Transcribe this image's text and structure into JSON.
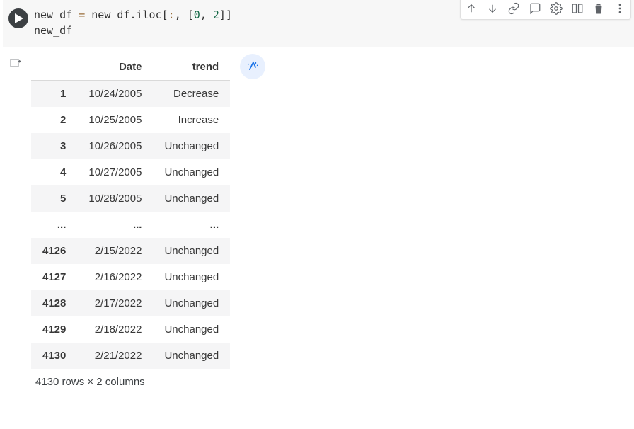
{
  "code": {
    "line1_pre": "new_df ",
    "line1_eq": "=",
    "line1_mid": " new_df.iloc",
    "line1_b1": "[",
    "line1_colon": ":",
    "line1_comma": ", ",
    "line1_b2": "[",
    "line1_n0": "0",
    "line1_sep": ", ",
    "line1_n2": "2",
    "line1_b3": "]",
    "line1_b4": "]",
    "line2": "new_df"
  },
  "columns": [
    "Date",
    "trend"
  ],
  "rows": [
    {
      "idx": "1",
      "Date": "10/24/2005",
      "trend": "Decrease"
    },
    {
      "idx": "2",
      "Date": "10/25/2005",
      "trend": "Increase"
    },
    {
      "idx": "3",
      "Date": "10/26/2005",
      "trend": "Unchanged"
    },
    {
      "idx": "4",
      "Date": "10/27/2005",
      "trend": "Unchanged"
    },
    {
      "idx": "5",
      "Date": "10/28/2005",
      "trend": "Unchanged"
    },
    {
      "idx": "...",
      "Date": "...",
      "trend": "..."
    },
    {
      "idx": "4126",
      "Date": "2/15/2022",
      "trend": "Unchanged"
    },
    {
      "idx": "4127",
      "Date": "2/16/2022",
      "trend": "Unchanged"
    },
    {
      "idx": "4128",
      "Date": "2/17/2022",
      "trend": "Unchanged"
    },
    {
      "idx": "4129",
      "Date": "2/18/2022",
      "trend": "Unchanged"
    },
    {
      "idx": "4130",
      "Date": "2/21/2022",
      "trend": "Unchanged"
    }
  ],
  "footer": "4130 rows × 2 columns"
}
